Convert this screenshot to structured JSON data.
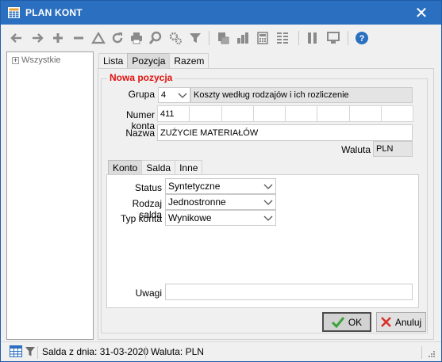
{
  "window": {
    "title": "PLAN KONT",
    "close_icon": "close-icon"
  },
  "toolbar": {
    "icons": [
      "arrow-left-icon",
      "arrow-right-icon",
      "plus-icon",
      "minus-icon",
      "triangle-icon",
      "refresh-icon",
      "print-icon",
      "zoom-icon",
      "settings-icon",
      "filter-icon",
      "document-icon",
      "chart-icon",
      "calculator-icon",
      "grid-icon",
      "columns-icon",
      "monitor-icon",
      "help-icon"
    ]
  },
  "tree": {
    "root_expander": "+",
    "root_label": "Wszystkie"
  },
  "tabs": [
    "Lista",
    "Pozycja",
    "Razem"
  ],
  "form": {
    "section_title": "Nowa pozycja",
    "grupa_label": "Grupa",
    "grupa_number": "4",
    "grupa_name": "Koszty według rodzajów i ich rozliczenie",
    "numer_konta_label": "Numer konta",
    "numer_konta_value": "411",
    "nazwa_label": "Nazwa",
    "nazwa_value": "ZUŻYCIE MATERIAŁÓW",
    "waluta_label": "Waluta",
    "waluta_value": "PLN",
    "uwagi_label": "Uwagi",
    "uwagi_value": ""
  },
  "subtabs": [
    "Konto",
    "Salda",
    "Inne"
  ],
  "konto": {
    "status_label": "Status",
    "status_value": "Syntetyczne",
    "rodzaj_salda_label": "Rodzaj salda",
    "rodzaj_salda_value": "Jednostronne",
    "typ_konta_label": "Typ konta",
    "typ_konta_value": "Wynikowe"
  },
  "buttons": {
    "ok_label": "OK",
    "cancel_label": "Anuluj"
  },
  "statusbar": {
    "salda_text": "Salda z dnia: 31-03-2020",
    "waluta_text": "Waluta: PLN"
  },
  "colors": {
    "titlebar": "#2b70c0",
    "accent_red": "#e0120f",
    "ok_check": "#3aa33a",
    "cancel_x": "#d9322b",
    "toolbar_icon": "#8a8a8a"
  }
}
